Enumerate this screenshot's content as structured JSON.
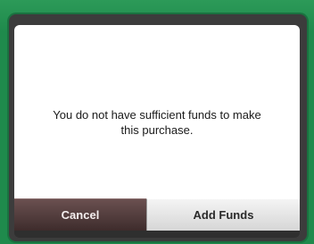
{
  "dialog": {
    "message": "You do not have sufficient funds to make this purchase.",
    "buttons": {
      "cancel_label": "Cancel",
      "add_funds_label": "Add Funds"
    }
  },
  "colors": {
    "background": "#1f8a4c",
    "frame": "#3c3c3c",
    "cancel_button": "#4e3a3a",
    "add_funds_button": "#e6e6e6"
  }
}
